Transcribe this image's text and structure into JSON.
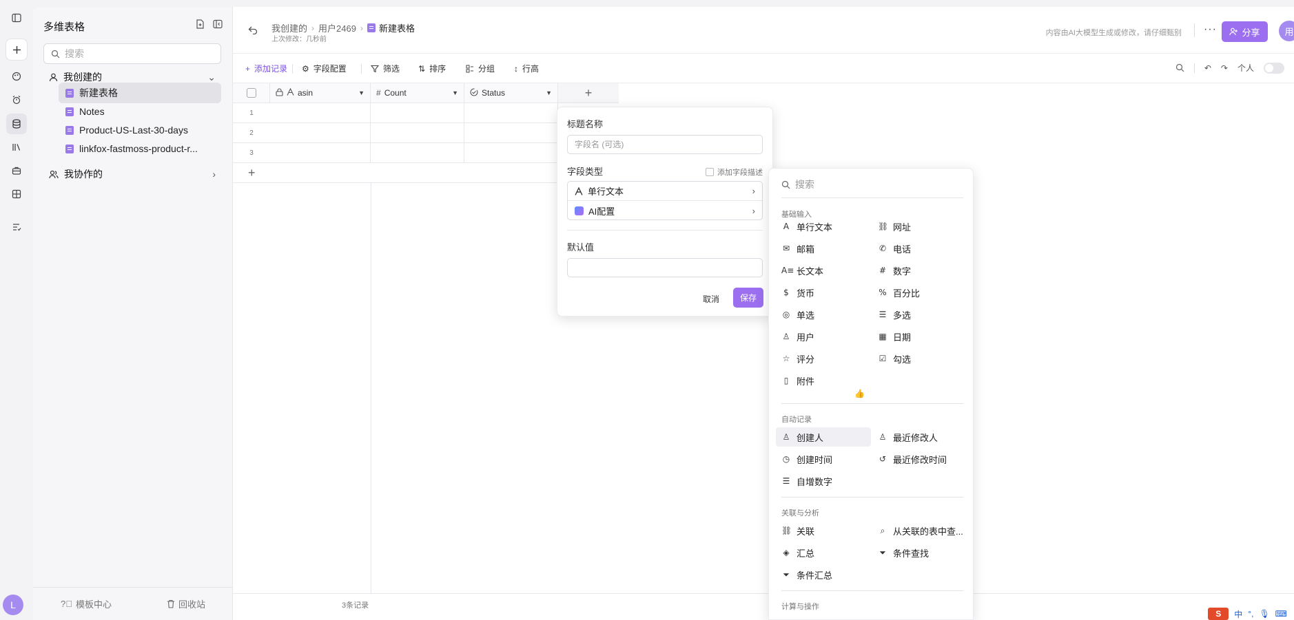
{
  "sidebar": {
    "title": "多维表格",
    "search_placeholder": "搜索",
    "my_created": "我创建的",
    "items": [
      {
        "label": "新建表格"
      },
      {
        "label": "Notes"
      },
      {
        "label": "Product-US-Last-30-days"
      },
      {
        "label": "linkfox-fastmoss-product-r..."
      }
    ],
    "my_collab": "我协作的",
    "footer": {
      "templates": "模板中心",
      "trash": "回收站"
    }
  },
  "rail": {
    "avatar": "L"
  },
  "header": {
    "crumbs": [
      "我创建的",
      "用户2469"
    ],
    "current": "新建表格",
    "subline": "上次修改：几秒前",
    "notice": "内容由AI大模型生成或修改，请仔细甄别",
    "share": "分享",
    "user_avatar": "用"
  },
  "toolbar": {
    "add_record": "添加记录",
    "field_config": "字段配置",
    "filter": "筛选",
    "sort": "排序",
    "group": "分组",
    "row_height": "行高",
    "personal": "个人"
  },
  "grid": {
    "columns": [
      {
        "name": "asin"
      },
      {
        "name": "Count"
      },
      {
        "name": "Status"
      }
    ],
    "rows": [
      "1",
      "2",
      "3"
    ],
    "record_count": "3条记录"
  },
  "popup": {
    "title_label": "标题名称",
    "title_placeholder": "字段名 (可选)",
    "type_label": "字段类型",
    "add_desc": "添加字段描述",
    "type_options": [
      "单行文本",
      "AI配置"
    ],
    "default_label": "默认值",
    "cancel": "取消",
    "save": "保存"
  },
  "typemenu": {
    "search_placeholder": "搜索",
    "sections": {
      "basic": "基础输入",
      "auto": "自动记录",
      "relation": "关联与分析",
      "calc": "计算与操作"
    },
    "basic_left": [
      "单行文本",
      "邮箱",
      "长文本",
      "货币",
      "单选",
      "用户",
      "评分",
      "附件"
    ],
    "basic_right": [
      "网址",
      "电话",
      "数字",
      "百分比",
      "多选",
      "日期",
      "勾选"
    ],
    "auto_left": [
      "创建人",
      "创建时间",
      "自增数字"
    ],
    "auto_right": [
      "最近修改人",
      "最近修改时间"
    ],
    "rel_left": [
      "关联",
      "汇总",
      "条件汇总"
    ],
    "rel_right": [
      "从关联的表中查...",
      "条件查找"
    ]
  },
  "ime": {
    "s": "S",
    "zh": "中"
  },
  "colors": {
    "accent": "#9b6ff0",
    "doc_icon": "#9a7ae8"
  }
}
